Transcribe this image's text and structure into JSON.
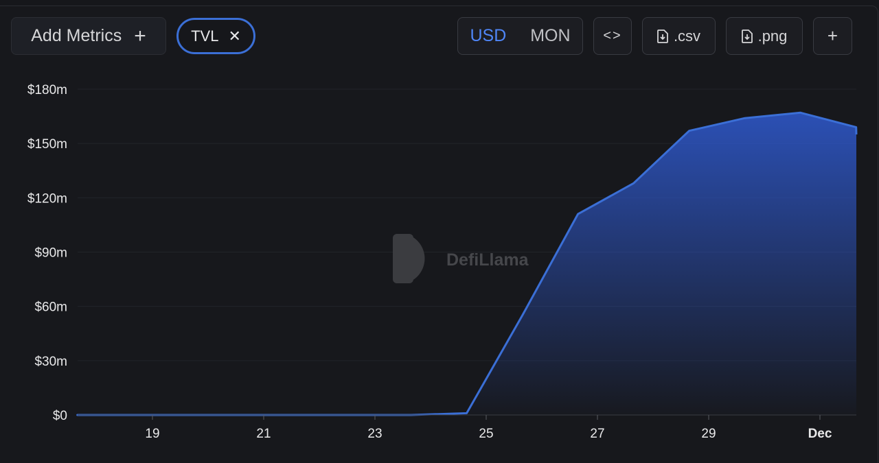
{
  "toolbar": {
    "add_metrics_label": "Add Metrics",
    "metric_chip": "TVL",
    "currency_active": "USD",
    "currency_other": "MON",
    "csv_label": ".csv",
    "png_label": ".png"
  },
  "watermark": {
    "text": "DefiLlama"
  },
  "colors": {
    "line": "#3b6fd6",
    "accent": "#4f86f7",
    "background": "#17181c"
  },
  "chart_data": {
    "type": "area",
    "x": [
      "Nov 17",
      "Nov 18",
      "Nov 19",
      "Nov 20",
      "Nov 21",
      "Nov 22",
      "Nov 23",
      "Nov 24",
      "Nov 25",
      "Nov 26",
      "Nov 27",
      "Nov 28",
      "Nov 29",
      "Nov 30",
      "Dec 1"
    ],
    "values": [
      0,
      0,
      0,
      0,
      0,
      0,
      0,
      1,
      55,
      111,
      128,
      157,
      164,
      167,
      159
    ],
    "last_value": 155,
    "x_tick_labels": [
      "19",
      "21",
      "23",
      "25",
      "27",
      "29",
      "Dec"
    ],
    "y_tick_labels": [
      "$0",
      "$30m",
      "$60m",
      "$90m",
      "$120m",
      "$150m",
      "$180m"
    ],
    "ylim": [
      0,
      180
    ],
    "grid": true
  }
}
